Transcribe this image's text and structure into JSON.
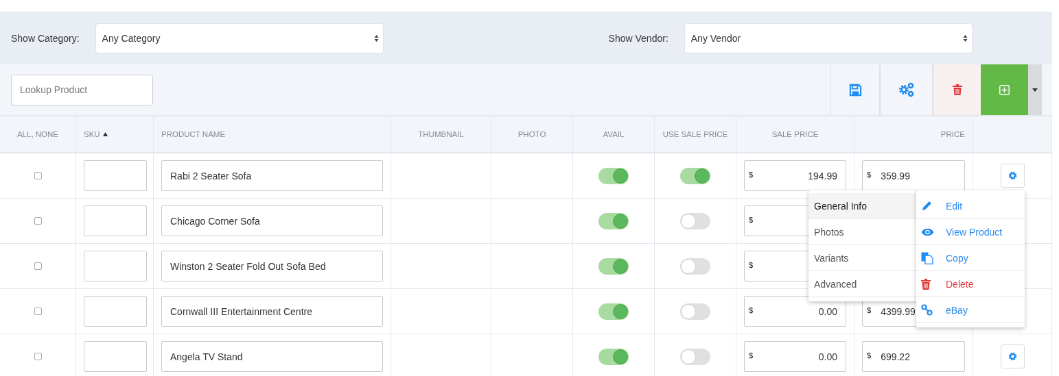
{
  "filters": [
    {
      "label": "Show Category:",
      "value": "Any Category"
    },
    {
      "label": "Show Vendor:",
      "value": "Any Vendor"
    }
  ],
  "search": {
    "placeholder": "Lookup Product"
  },
  "toolbar": [
    {
      "kind": "save"
    },
    {
      "kind": "gears"
    },
    {
      "kind": "delete"
    },
    {
      "kind": "add"
    },
    {
      "kind": "caret"
    }
  ],
  "columns": [
    {
      "label": "ALL, NONE",
      "sorted": false
    },
    {
      "label": "SKU",
      "sorted": true
    },
    {
      "label": "PRODUCT NAME",
      "sorted": false
    },
    {
      "label": "THUMBNAIL",
      "sorted": false
    },
    {
      "label": "PHOTO",
      "sorted": false
    },
    {
      "label": "AVAIL",
      "sorted": false
    },
    {
      "label": "USE SALE PRICE",
      "sorted": false
    },
    {
      "label": "SALE PRICE",
      "sorted": false
    },
    {
      "label": "PRICE",
      "sorted": false
    }
  ],
  "rows": [
    {
      "checked": false,
      "name": "Rabi 2 Seater Sofa",
      "avail": true,
      "use_sale_price": true,
      "sale_currency": "$",
      "sale_price": "194.99",
      "price_currency": "$",
      "price": "359.99",
      "settings_button": true
    },
    {
      "checked": false,
      "name": "Chicago Corner Sofa",
      "avail": true,
      "use_sale_price": false,
      "sale_currency": "$",
      "settings_button": false
    },
    {
      "checked": false,
      "name": "Winston 2 Seater Fold Out Sofa Bed",
      "avail": true,
      "use_sale_price": false,
      "sale_currency": "$",
      "settings_button": false
    },
    {
      "checked": false,
      "name": "Cornwall III Entertainment Centre",
      "avail": true,
      "use_sale_price": false,
      "sale_currency": "$",
      "sale_price": "0.00",
      "price_currency": "$",
      "price": "4399.99",
      "settings_button": false
    },
    {
      "checked": false,
      "name": "Angela TV Stand",
      "avail": true,
      "use_sale_price": false,
      "sale_currency": "$",
      "sale_price": "0.00",
      "price_currency": "$",
      "price": "699.22",
      "settings_button": true
    }
  ],
  "row_menu": {
    "sections": [
      {
        "label": "General Info",
        "selected": true
      },
      {
        "label": "Photos",
        "selected": false
      },
      {
        "label": "Variants",
        "selected": false
      },
      {
        "label": "Advanced",
        "selected": false
      }
    ],
    "actions": [
      {
        "kind": "edit",
        "label": "Edit"
      },
      {
        "kind": "view",
        "label": "View Product"
      },
      {
        "kind": "copy",
        "label": "Copy"
      },
      {
        "kind": "delete",
        "label": "Delete"
      },
      {
        "kind": "link",
        "label": "eBay"
      }
    ]
  }
}
